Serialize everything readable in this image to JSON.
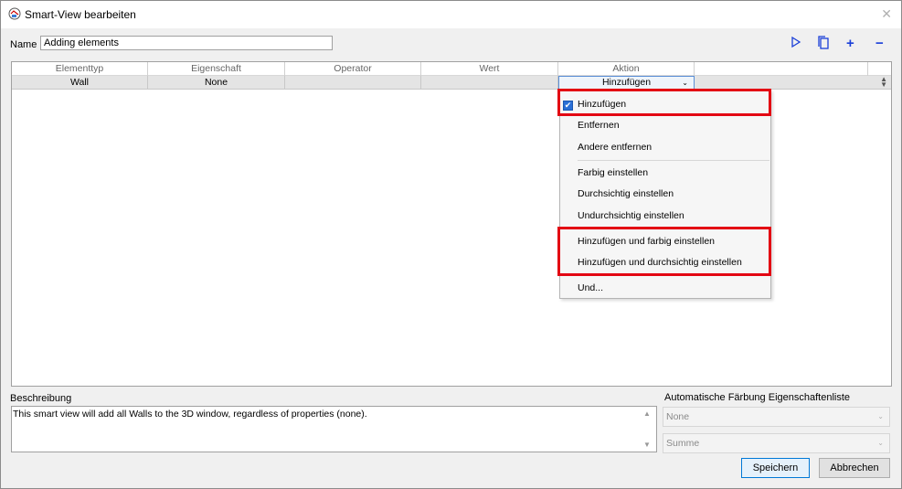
{
  "window": {
    "title": "Smart-View bearbeiten",
    "close_icon": "close-icon"
  },
  "form": {
    "name_label": "Name",
    "name_value": "Adding elements"
  },
  "toolbar": {
    "play_icon": "play-icon",
    "copy_icon": "copy-icon",
    "add_icon": "plus-icon",
    "remove_icon": "minus-icon",
    "icon_color": "#1a3fd8"
  },
  "grid": {
    "columns": [
      "Elementtyp",
      "Eigenschaft",
      "Operator",
      "Wert",
      "Aktion"
    ],
    "rows": [
      {
        "elementtyp": "Wall",
        "eigenschaft": "None",
        "operator": "",
        "wert": "",
        "aktion": "Hinzufügen"
      }
    ]
  },
  "dropdown": {
    "items": [
      "Hinzufügen",
      "Entfernen",
      "Andere entfernen",
      "Farbig einstellen",
      "Durchsichtig einstellen",
      "Undurchsichtig einstellen",
      "Hinzufügen und farbig einstellen",
      "Hinzufügen und durchsichtig einstellen",
      "Und..."
    ],
    "selected": "Hinzufügen",
    "highlight_color": "#e30613"
  },
  "description": {
    "label": "Beschreibung",
    "text": "This smart view will add all Walls to the 3D window, regardless of properties (none)."
  },
  "auto_coloring": {
    "label": "Automatische Färbung Eigenschaftenliste",
    "property": "None",
    "aggregate": "Summe"
  },
  "buttons": {
    "save": "Speichern",
    "cancel": "Abbrechen"
  }
}
